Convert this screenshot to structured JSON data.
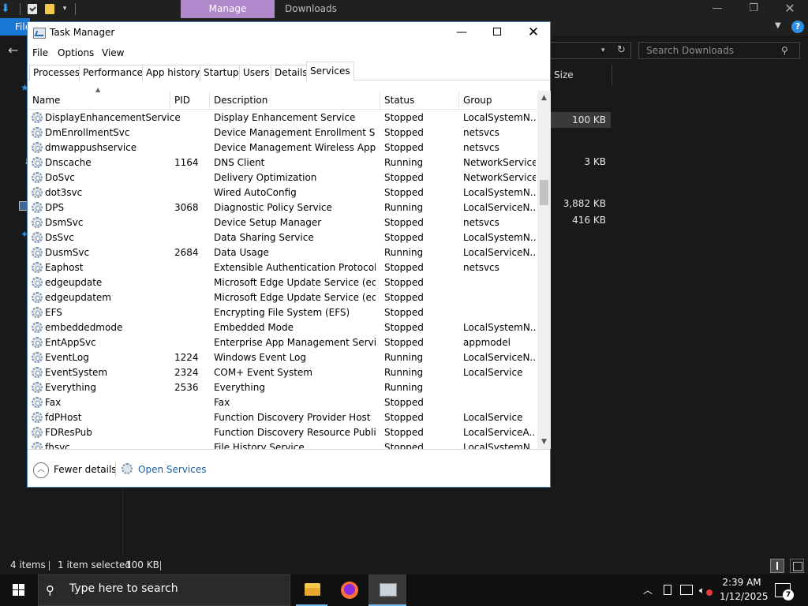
{
  "explorer": {
    "window_title": "Downloads",
    "ribbon_context_tab": "Manage",
    "file_tab": "File",
    "search_placeholder": "Search Downloads",
    "column_size": "Size",
    "file_sizes": [
      "100 KB",
      "3 KB",
      "3,882 KB",
      "416 KB"
    ],
    "status": {
      "items": "4 items",
      "selected": "1 item selected",
      "selected_size": "100 KB"
    }
  },
  "taskmgr": {
    "title": "Task Manager",
    "menu": [
      "File",
      "Options",
      "View"
    ],
    "tabs": [
      "Processes",
      "Performance",
      "App history",
      "Startup",
      "Users",
      "Details",
      "Services"
    ],
    "active_tab": "Services",
    "columns": [
      "Name",
      "PID",
      "Description",
      "Status",
      "Group"
    ],
    "services": [
      {
        "name": "DisplayEnhancementService",
        "pid": "",
        "desc": "Display Enhancement Service",
        "status": "Stopped",
        "group": "LocalSystemN..."
      },
      {
        "name": "DmEnrollmentSvc",
        "pid": "",
        "desc": "Device Management Enrollment Ser...",
        "status": "Stopped",
        "group": "netsvcs"
      },
      {
        "name": "dmwappushservice",
        "pid": "",
        "desc": "Device Management Wireless Applic...",
        "status": "Stopped",
        "group": "netsvcs"
      },
      {
        "name": "Dnscache",
        "pid": "1164",
        "desc": "DNS Client",
        "status": "Running",
        "group": "NetworkService"
      },
      {
        "name": "DoSvc",
        "pid": "",
        "desc": "Delivery Optimization",
        "status": "Stopped",
        "group": "NetworkService"
      },
      {
        "name": "dot3svc",
        "pid": "",
        "desc": "Wired AutoConfig",
        "status": "Stopped",
        "group": "LocalSystemN..."
      },
      {
        "name": "DPS",
        "pid": "3068",
        "desc": "Diagnostic Policy Service",
        "status": "Running",
        "group": "LocalServiceN..."
      },
      {
        "name": "DsmSvc",
        "pid": "",
        "desc": "Device Setup Manager",
        "status": "Stopped",
        "group": "netsvcs"
      },
      {
        "name": "DsSvc",
        "pid": "",
        "desc": "Data Sharing Service",
        "status": "Stopped",
        "group": "LocalSystemN..."
      },
      {
        "name": "DusmSvc",
        "pid": "2684",
        "desc": "Data Usage",
        "status": "Running",
        "group": "LocalServiceN..."
      },
      {
        "name": "Eaphost",
        "pid": "",
        "desc": "Extensible Authentication Protocol",
        "status": "Stopped",
        "group": "netsvcs"
      },
      {
        "name": "edgeupdate",
        "pid": "",
        "desc": "Microsoft Edge Update Service (edg...",
        "status": "Stopped",
        "group": ""
      },
      {
        "name": "edgeupdatem",
        "pid": "",
        "desc": "Microsoft Edge Update Service (edg...",
        "status": "Stopped",
        "group": ""
      },
      {
        "name": "EFS",
        "pid": "",
        "desc": "Encrypting File System (EFS)",
        "status": "Stopped",
        "group": ""
      },
      {
        "name": "embeddedmode",
        "pid": "",
        "desc": "Embedded Mode",
        "status": "Stopped",
        "group": "LocalSystemN..."
      },
      {
        "name": "EntAppSvc",
        "pid": "",
        "desc": "Enterprise App Management Service",
        "status": "Stopped",
        "group": "appmodel"
      },
      {
        "name": "EventLog",
        "pid": "1224",
        "desc": "Windows Event Log",
        "status": "Running",
        "group": "LocalServiceN..."
      },
      {
        "name": "EventSystem",
        "pid": "2324",
        "desc": "COM+ Event System",
        "status": "Running",
        "group": "LocalService"
      },
      {
        "name": "Everything",
        "pid": "2536",
        "desc": "Everything",
        "status": "Running",
        "group": ""
      },
      {
        "name": "Fax",
        "pid": "",
        "desc": "Fax",
        "status": "Stopped",
        "group": ""
      },
      {
        "name": "fdPHost",
        "pid": "",
        "desc": "Function Discovery Provider Host",
        "status": "Stopped",
        "group": "LocalService"
      },
      {
        "name": "FDResPub",
        "pid": "",
        "desc": "Function Discovery Resource Public...",
        "status": "Stopped",
        "group": "LocalServiceA..."
      },
      {
        "name": "fhsvc",
        "pid": "",
        "desc": "File History Service",
        "status": "Stopped",
        "group": "LocalSystemN..."
      }
    ],
    "footer": {
      "fewer_details": "Fewer details",
      "open_services": "Open Services"
    }
  },
  "taskbar": {
    "search_placeholder": "Type here to search",
    "clock_time": "2:39 AM",
    "clock_date": "1/12/2025",
    "notification_count": "7"
  }
}
